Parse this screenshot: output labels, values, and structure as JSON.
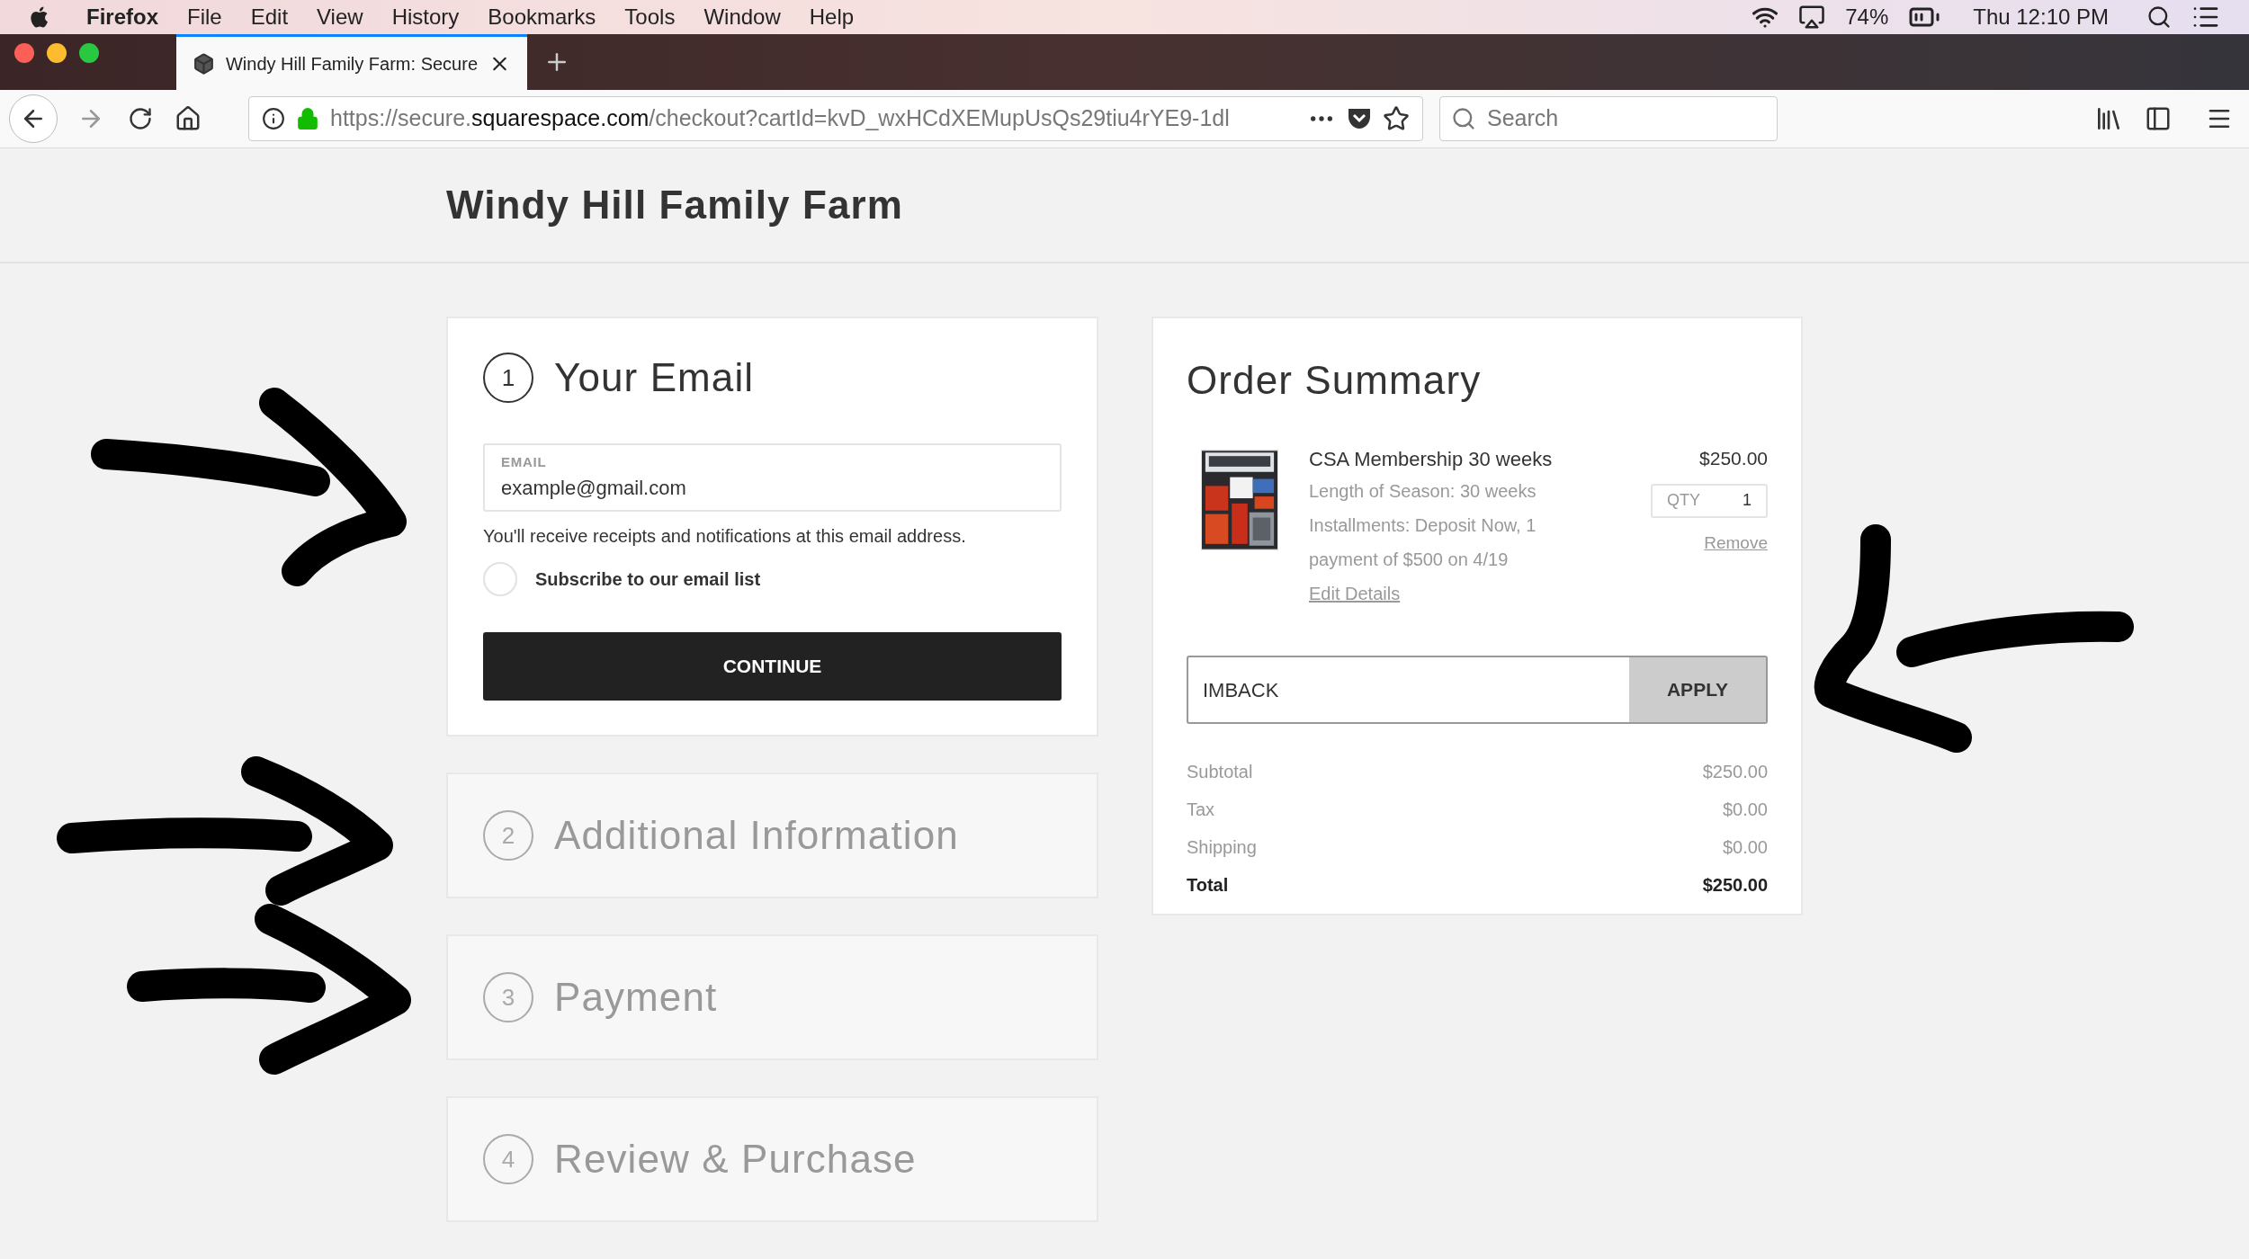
{
  "menu_bar": {
    "app": "Firefox",
    "items": [
      "File",
      "Edit",
      "View",
      "History",
      "Bookmarks",
      "Tools",
      "Window",
      "Help"
    ],
    "battery": "74%",
    "clock": "Thu 12:10 PM"
  },
  "tabs": [
    {
      "title": "Windy Hill Family Farm: Secure",
      "selected": true
    }
  ],
  "toolbar": {
    "url_prefix": "https://secure.",
    "url_domain": "squarespace.com",
    "url_path": "/checkout?cartId=kvD_wxHCdXEMupUsQs29tiu4rYE9-1dl",
    "search_placeholder": "Search"
  },
  "site_title": "Windy Hill Family Farm",
  "steps": [
    {
      "number": "1",
      "title": "Your Email",
      "expanded": true
    },
    {
      "number": "2",
      "title": "Additional Information",
      "expanded": false
    },
    {
      "number": "3",
      "title": "Payment",
      "expanded": false
    },
    {
      "number": "4",
      "title": "Review & Purchase",
      "expanded": false
    }
  ],
  "email_form": {
    "label": "EMAIL",
    "value": "example@gmail.com",
    "note": "You'll receive receipts and notifications at this email address.",
    "subscribe_label": "Subscribe to our email list",
    "subscribe_checked": false,
    "button": "CONTINUE"
  },
  "order_summary": {
    "title": "Order Summary",
    "item": {
      "name": "CSA Membership 30 weeks",
      "price": "$250.00",
      "details": [
        "Length of Season: 30 weeks",
        "Installments: Deposit Now, 1 payment of $500 on 4/19"
      ],
      "qty_label": "QTY",
      "qty": "1",
      "remove": "Remove",
      "edit": "Edit Details"
    },
    "promo": {
      "value": "IMBACK",
      "button": "APPLY"
    },
    "totals": [
      {
        "label": "Subtotal",
        "value": "$250.00",
        "kind": "line"
      },
      {
        "label": "Tax",
        "value": "$0.00",
        "kind": "line"
      },
      {
        "label": "Shipping",
        "value": "$0.00",
        "kind": "line"
      },
      {
        "label": "Total",
        "value": "$250.00",
        "kind": "total"
      }
    ]
  }
}
